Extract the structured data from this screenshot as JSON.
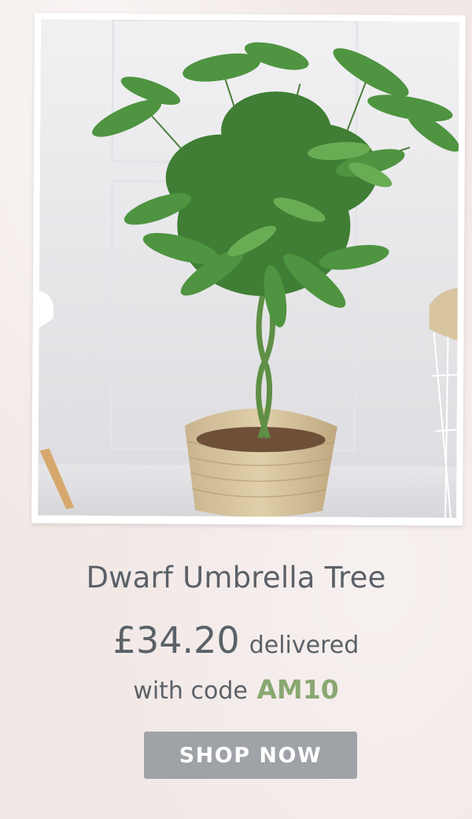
{
  "product": {
    "name": "Dwarf Umbrella Tree",
    "price": "£34.20",
    "price_suffix": "delivered",
    "code_prefix": "with code",
    "code": "AM10"
  },
  "cta": {
    "label": "SHOP NOW"
  },
  "colors": {
    "text": "#5b6168",
    "code": "#8aa872",
    "button": "#9fa2a6",
    "background": "#f2e9e7"
  },
  "image": {
    "subject": "plant-photo"
  }
}
